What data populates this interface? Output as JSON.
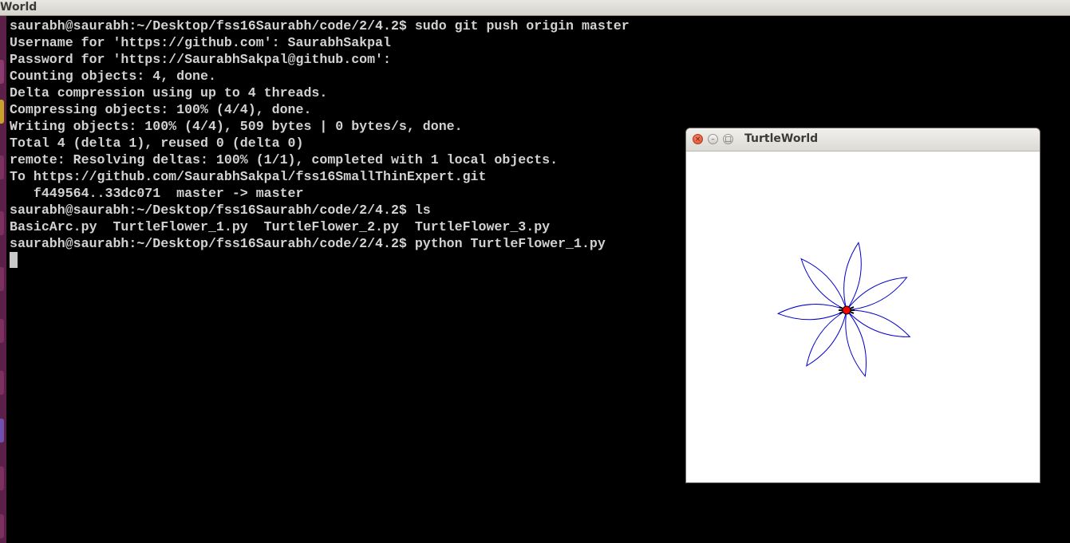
{
  "top_bar": {
    "title": "World"
  },
  "terminal": {
    "lines": [
      "saurabh@saurabh:~/Desktop/fss16Saurabh/code/2/4.2$ sudo git push origin master",
      "Username for 'https://github.com': SaurabhSakpal",
      "Password for 'https://SaurabhSakpal@github.com':",
      "Counting objects: 4, done.",
      "Delta compression using up to 4 threads.",
      "Compressing objects: 100% (4/4), done.",
      "Writing objects: 100% (4/4), 509 bytes | 0 bytes/s, done.",
      "Total 4 (delta 1), reused 0 (delta 0)",
      "remote: Resolving deltas: 100% (1/1), completed with 1 local objects.",
      "To https://github.com/SaurabhSakpal/fss16SmallThinExpert.git",
      "   f449564..33dc071  master -> master",
      "saurabh@saurabh:~/Desktop/fss16Saurabh/code/2/4.2$ ls",
      "BasicArc.py  TurtleFlower_1.py  TurtleFlower_2.py  TurtleFlower_3.py",
      "saurabh@saurabh:~/Desktop/fss16Saurabh/code/2/4.2$ python TurtleFlower_1.py"
    ]
  },
  "turtle_window": {
    "title": "TurtleWorld",
    "close_glyph": "×",
    "minimize_glyph": "–",
    "maximize_glyph": "□",
    "flower": {
      "petals": 7,
      "stroke_color": "#0000cc",
      "turtle_color": "#ff0000"
    }
  },
  "colors": {
    "terminal_bg": "#000000",
    "terminal_text": "#d2d2d2",
    "launcher": "#5a2047"
  }
}
